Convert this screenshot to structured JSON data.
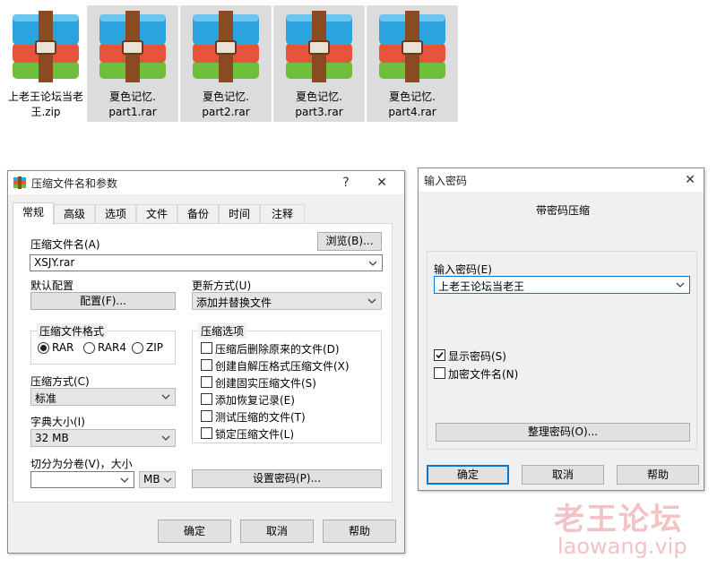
{
  "files": [
    {
      "line1": "上老王论坛当老",
      "line2": "王.zip",
      "selected": false
    },
    {
      "line1": "夏色记忆.",
      "line2": "part1.rar",
      "selected": true
    },
    {
      "line1": "夏色记忆.",
      "line2": "part2.rar",
      "selected": true
    },
    {
      "line1": "夏色记忆.",
      "line2": "part3.rar",
      "selected": true
    },
    {
      "line1": "夏色记忆.",
      "line2": "part4.rar",
      "selected": true
    }
  ],
  "archive_dialog": {
    "title": "压缩文件名和参数",
    "help_glyph": "?",
    "close_glyph": "✕",
    "tabs": [
      "常规",
      "高级",
      "选项",
      "文件",
      "备份",
      "时间",
      "注释"
    ],
    "archive_name_label": "压缩文件名(A)",
    "browse_label": "浏览(B)...",
    "archive_name_value": "XSJY.rar",
    "default_profile_label": "默认配置",
    "profiles_button": "配置(F)...",
    "update_mode_label": "更新方式(U)",
    "update_mode_value": "添加并替换文件",
    "format_group_title": "压缩文件格式",
    "formats": [
      "RAR",
      "RAR4",
      "ZIP"
    ],
    "selected_format": "RAR",
    "options_group_title": "压缩选项",
    "options": [
      {
        "label": "压缩后删除原来的文件(D)",
        "checked": false
      },
      {
        "label": "创建自解压格式压缩文件(X)",
        "checked": false
      },
      {
        "label": "创建固实压缩文件(S)",
        "checked": false
      },
      {
        "label": "添加恢复记录(E)",
        "checked": false
      },
      {
        "label": "测试压缩的文件(T)",
        "checked": false
      },
      {
        "label": "锁定压缩文件(L)",
        "checked": false
      }
    ],
    "method_label": "压缩方式(C)",
    "method_value": "标准",
    "dict_label": "字典大小(I)",
    "dict_value": "32 MB",
    "split_label": "切分为分卷(V)，大小",
    "split_value": "",
    "split_unit": "MB",
    "set_password_button": "设置密码(P)...",
    "ok_button": "确定",
    "cancel_button": "取消",
    "help_button": "帮助"
  },
  "password_dialog": {
    "title": "输入密码",
    "close_glyph": "✕",
    "heading": "带密码压缩",
    "password_label": "输入密码(E)",
    "password_value": "上老王论坛当老王",
    "show_password_label": "显示密码(S)",
    "show_password_checked": true,
    "encrypt_names_label": "加密文件名(N)",
    "encrypt_names_checked": false,
    "organize_button": "整理密码(O)...",
    "ok_button": "确定",
    "cancel_button": "取消",
    "help_button": "帮助"
  },
  "watermark": {
    "line1": "老王论坛",
    "line2": "laowang.vip"
  }
}
